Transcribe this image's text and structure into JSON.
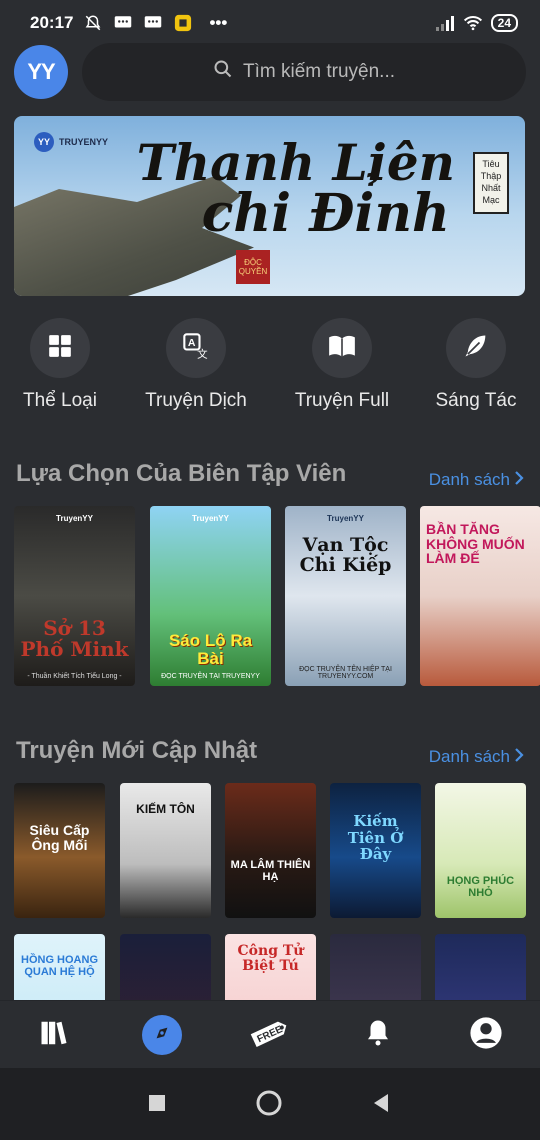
{
  "status": {
    "time": "20:17",
    "battery": "24",
    "more": "•••"
  },
  "search": {
    "placeholder": "Tìm kiếm truyện..."
  },
  "avatar": {
    "initials": "YY"
  },
  "banner": {
    "brand": "TRUYENYY",
    "title_line1": "Thanh Liên",
    "title_line2": "chi Đỉnh",
    "tag": "Tiêu Thập Nhất Mạc",
    "seal": "ĐỘC QUYỀN"
  },
  "categories": [
    {
      "label": "Thể Loại",
      "icon": "grid-icon"
    },
    {
      "label": "Truyện Dịch",
      "icon": "translate-icon"
    },
    {
      "label": "Truyện Full",
      "icon": "book-open-icon"
    },
    {
      "label": "Sáng Tác",
      "icon": "feather-icon"
    }
  ],
  "editors_pick": {
    "title": "Lựa Chọn Của Biên Tập Viên",
    "link": "Danh sách",
    "books": [
      {
        "title": "Sở 13 Phố Mink",
        "badge": "TruyenYY",
        "sub": "- Thuần Khiết Tích Tiểu Long -"
      },
      {
        "title": "Sáo Lộ Ra Bài",
        "badge": "TruyenYY",
        "sub": "ĐỌC TRUYỆN TẠI TRUYENYY"
      },
      {
        "title": "Vạn Tộc Chi Kiếp",
        "badge": "TruyenYY",
        "sub": "ĐỌC TRUYỆN TÊN HIỆP TẠI TRUYENYY.COM"
      },
      {
        "title": "BẦN TĂNG KHÔNG MUỐN LÀM ĐẾ",
        "badge": "",
        "sub": ""
      }
    ]
  },
  "latest": {
    "title": "Truyện Mới Cập Nhật",
    "link": "Danh sách",
    "row1": [
      {
        "title": "Siêu Cấp Ông Mối"
      },
      {
        "title": "KIẾM TÔN"
      },
      {
        "title": "MA LÂM THIÊN HẠ"
      },
      {
        "title": "Kiếm Tiên Ở Đây"
      },
      {
        "title": "HỌNG PHÚC NHỎ"
      }
    ],
    "row2": [
      {
        "title": "HỒNG HOANG QUAN HỆ HỘ"
      },
      {
        "title": ""
      },
      {
        "title": "Công Tử Biệt Tú"
      },
      {
        "title": ""
      },
      {
        "title": ""
      }
    ]
  },
  "tabs": [
    {
      "icon": "bookshelf-icon"
    },
    {
      "icon": "compass-icon"
    },
    {
      "icon": "free-tag-icon",
      "label": "FREE"
    },
    {
      "icon": "bell-icon"
    },
    {
      "icon": "account-icon"
    }
  ],
  "colors": {
    "accent": "#4a86e8",
    "link": "#4a90e2",
    "background": "#2b2d31"
  }
}
